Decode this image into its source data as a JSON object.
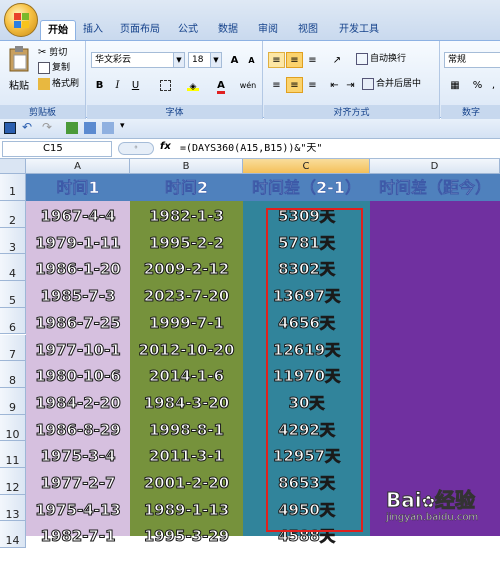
{
  "tabs": [
    "开始",
    "插入",
    "页面布局",
    "公式",
    "数据",
    "审阅",
    "视图",
    "开发工具"
  ],
  "ribbon": {
    "clipboard": {
      "paste": "粘贴",
      "cut": "剪切",
      "copy": "复制",
      "format_painter": "格式刷",
      "label": "剪贴板"
    },
    "font": {
      "name": "华文彩云",
      "size": "18",
      "grow": "A",
      "shrink": "A",
      "bold": "B",
      "italic": "I",
      "underline": "U",
      "phonetic": "wén",
      "label": "字体"
    },
    "alignment": {
      "wrap": "自动换行",
      "merge": "合并后居中",
      "label": "对齐方式"
    },
    "number": {
      "format": "常规",
      "percent": "%",
      "comma": ",",
      "label": "数字"
    }
  },
  "formula_bar": {
    "cell_ref": "C15",
    "fx": "fx",
    "formula": "=(DAYS360(A15,B15))&\"天\""
  },
  "columns": [
    "A",
    "B",
    "C",
    "D"
  ],
  "header_row": [
    "时间1",
    "时间2",
    "时间差（2-1）",
    "时间差（距今）"
  ],
  "rows": [
    {
      "n": "2",
      "a": "1967-4-4",
      "b": "1982-1-3",
      "c": "5309天"
    },
    {
      "n": "3",
      "a": "1979-1-11",
      "b": "1995-2-2",
      "c": "5781天"
    },
    {
      "n": "4",
      "a": "1986-1-20",
      "b": "2009-2-12",
      "c": "8302天"
    },
    {
      "n": "5",
      "a": "1985-7-3",
      "b": "2023-7-20",
      "c": "13697天"
    },
    {
      "n": "6",
      "a": "1986-7-25",
      "b": "1999-7-1",
      "c": "4656天"
    },
    {
      "n": "7",
      "a": "1977-10-1",
      "b": "2012-10-20",
      "c": "12619天"
    },
    {
      "n": "8",
      "a": "1980-10-6",
      "b": "2014-1-6",
      "c": "11970天"
    },
    {
      "n": "9",
      "a": "1984-2-20",
      "b": "1984-3-20",
      "c": "30天"
    },
    {
      "n": "10",
      "a": "1986-8-29",
      "b": "1998-8-1",
      "c": "4292天"
    },
    {
      "n": "11",
      "a": "1975-3-4",
      "b": "2011-3-1",
      "c": "12957天"
    },
    {
      "n": "12",
      "a": "1977-2-7",
      "b": "2001-2-20",
      "c": "8653天"
    },
    {
      "n": "13",
      "a": "1975-4-13",
      "b": "1989-1-13",
      "c": "4950天"
    },
    {
      "n": "14",
      "a": "1982-7-1",
      "b": "1995-3-29",
      "c": "4588天"
    }
  ],
  "row1_num": "1",
  "watermark": {
    "brand": "Bai",
    "brand2": "经验",
    "url": "jingyan.baidu.com"
  },
  "colors": {
    "colA": "#d6c0df",
    "colB": "#76923c",
    "colC": "#31849b",
    "colD": "#7030a0",
    "header": "#4f81bd"
  }
}
